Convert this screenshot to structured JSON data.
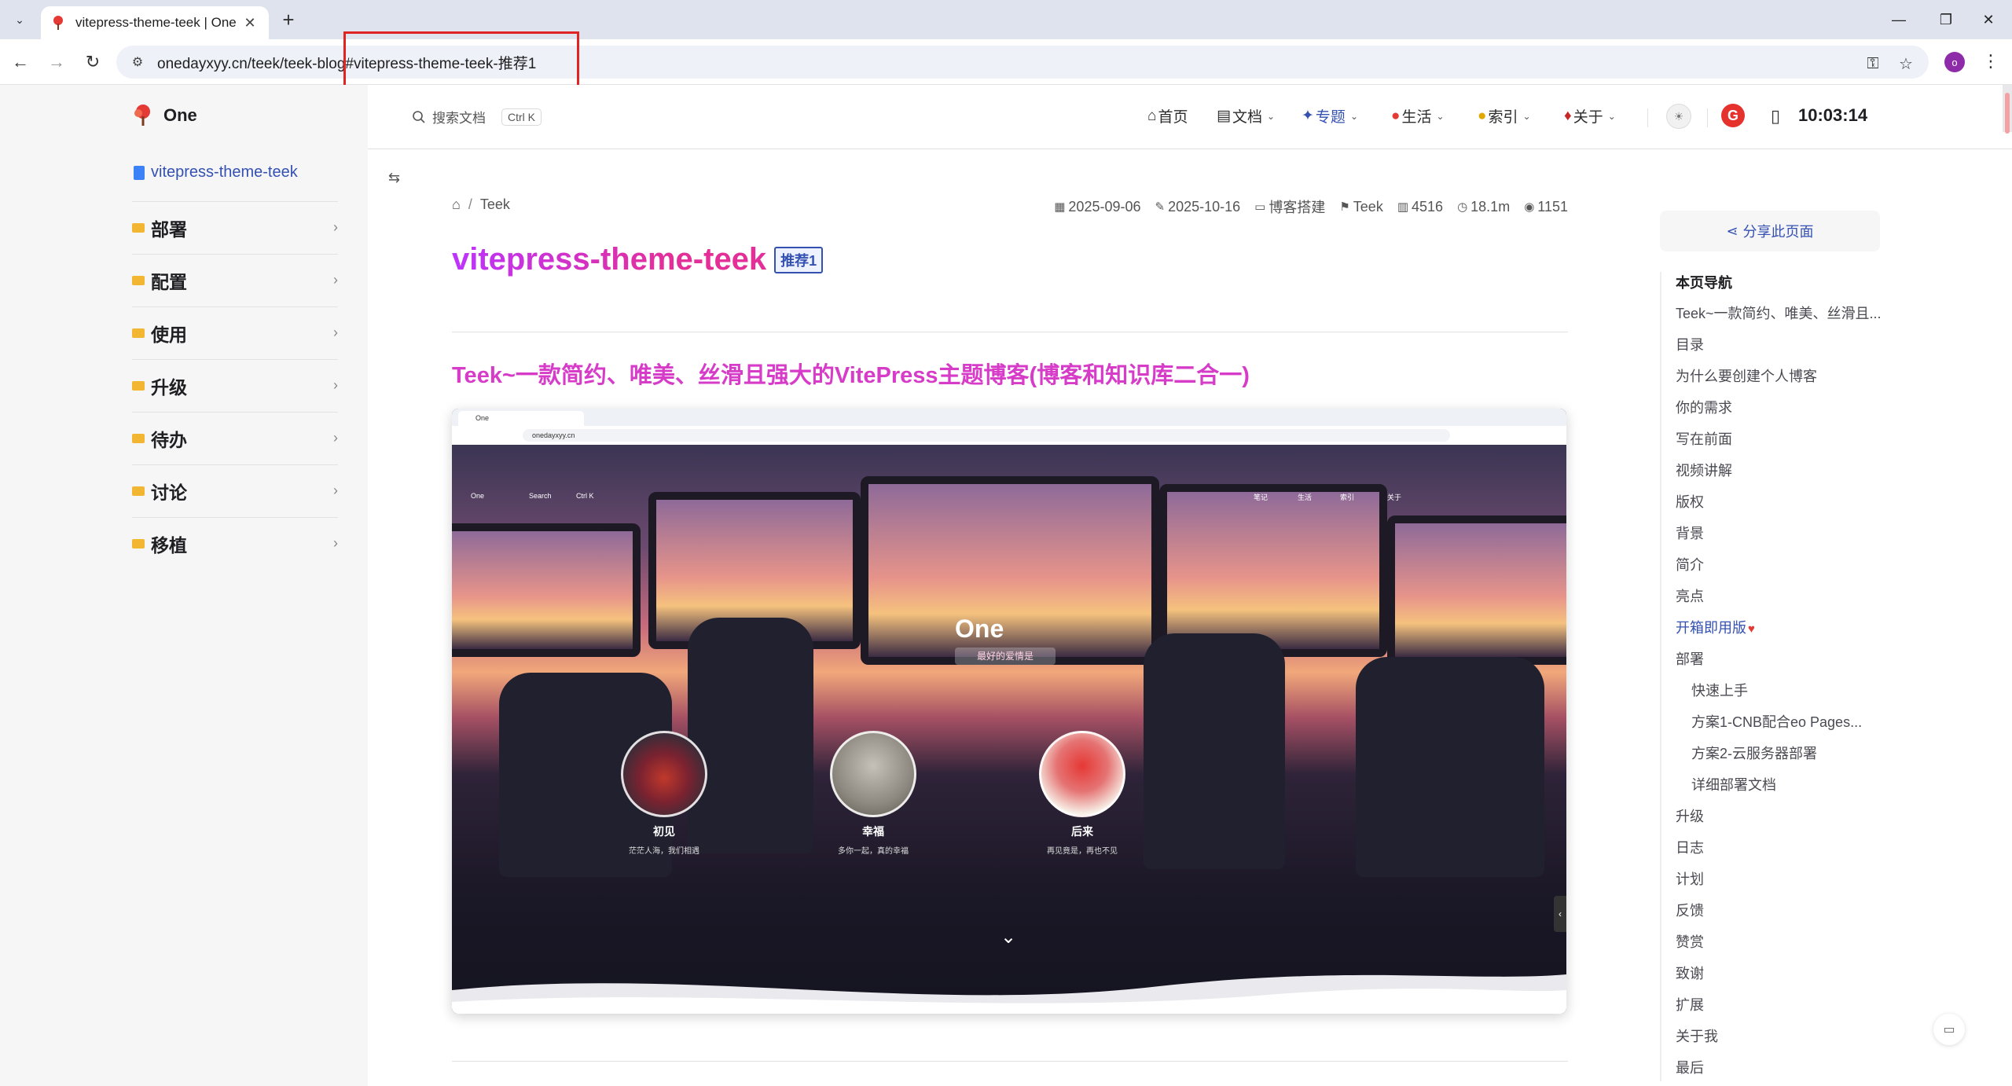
{
  "browser": {
    "tab_title": "vitepress-theme-teek | One",
    "url": "onedayxyy.cn/teek/teek-blog#vitepress-theme-teek-推荐1",
    "profile_initial": "o",
    "colors": {
      "highlight_box": "#e02424",
      "profile": "#8e2ba8"
    }
  },
  "site": {
    "logo_text": "One",
    "search_placeholder": "搜索文档",
    "search_shortcut": "Ctrl K",
    "clock": "10:03:14",
    "nav": [
      {
        "label": "首页",
        "icon": "home-icon",
        "dropdown": false
      },
      {
        "label": "文档",
        "icon": "doc-icon",
        "dropdown": true
      },
      {
        "label": "专题",
        "icon": "topic-icon",
        "dropdown": true,
        "active": true
      },
      {
        "label": "生活",
        "icon": "life-icon",
        "dropdown": true
      },
      {
        "label": "索引",
        "icon": "index-icon",
        "dropdown": true
      },
      {
        "label": "关于",
        "icon": "about-icon",
        "dropdown": true
      }
    ]
  },
  "sidebar": {
    "doc_link": "vitepress-theme-teek",
    "items": [
      {
        "label": "部署"
      },
      {
        "label": "配置"
      },
      {
        "label": "使用"
      },
      {
        "label": "升级"
      },
      {
        "label": "待办"
      },
      {
        "label": "讨论"
      },
      {
        "label": "移植"
      }
    ]
  },
  "article": {
    "breadcrumb": "Teek",
    "meta": {
      "created": "2025-09-06",
      "updated": "2025-10-16",
      "category": "博客搭建",
      "tag": "Teek",
      "words": "4516",
      "read_time": "18.1m",
      "views": "1151"
    },
    "title": "vitepress-theme-teek",
    "badge": "推荐1",
    "heading": "Teek~一款简约、唯美、丝滑且强大的VitePress主题博客(博客和知识库二合一)",
    "screenshot": {
      "tab_title": "One",
      "url": "onedayxyy.cn",
      "logo_text": "One",
      "search_text": "Search",
      "search_shortcut": "Ctrl K",
      "hero_title": "One",
      "hero_subtitle": "最好的爱情是",
      "nav": [
        "笔记",
        "生活",
        "索引",
        "关于"
      ],
      "cards": [
        {
          "title": "初见",
          "desc": "茫茫人海，我们相遇"
        },
        {
          "title": "幸福",
          "desc": "多你一起，真的幸福"
        },
        {
          "title": "后来",
          "desc": "再见竟是，再也不见"
        }
      ]
    }
  },
  "outline": {
    "share_label": "分享此页面",
    "title": "本页导航",
    "items": [
      {
        "label": "Teek~一款简约、唯美、丝滑且...",
        "level": 1
      },
      {
        "label": "目录",
        "level": 1
      },
      {
        "label": "为什么要创建个人博客",
        "level": 1
      },
      {
        "label": "你的需求",
        "level": 1
      },
      {
        "label": "写在前面",
        "level": 1
      },
      {
        "label": "视频讲解",
        "level": 1
      },
      {
        "label": "版权",
        "level": 1
      },
      {
        "label": "背景",
        "level": 1
      },
      {
        "label": "简介",
        "level": 1
      },
      {
        "label": "亮点",
        "level": 1
      },
      {
        "label": "开箱即用版",
        "level": 1,
        "active": true,
        "heart": true
      },
      {
        "label": "部署",
        "level": 1
      },
      {
        "label": "快速上手",
        "level": 2
      },
      {
        "label": "方案1-CNB配合eo Pages...",
        "level": 2
      },
      {
        "label": "方案2-云服务器部署",
        "level": 2
      },
      {
        "label": "详细部署文档",
        "level": 2
      },
      {
        "label": "升级",
        "level": 1
      },
      {
        "label": "日志",
        "level": 1
      },
      {
        "label": "计划",
        "level": 1
      },
      {
        "label": "反馈",
        "level": 1
      },
      {
        "label": "赞赏",
        "level": 1
      },
      {
        "label": "致谢",
        "level": 1
      },
      {
        "label": "扩展",
        "level": 1
      },
      {
        "label": "关于我",
        "level": 1
      },
      {
        "label": "最后",
        "level": 1
      }
    ]
  }
}
